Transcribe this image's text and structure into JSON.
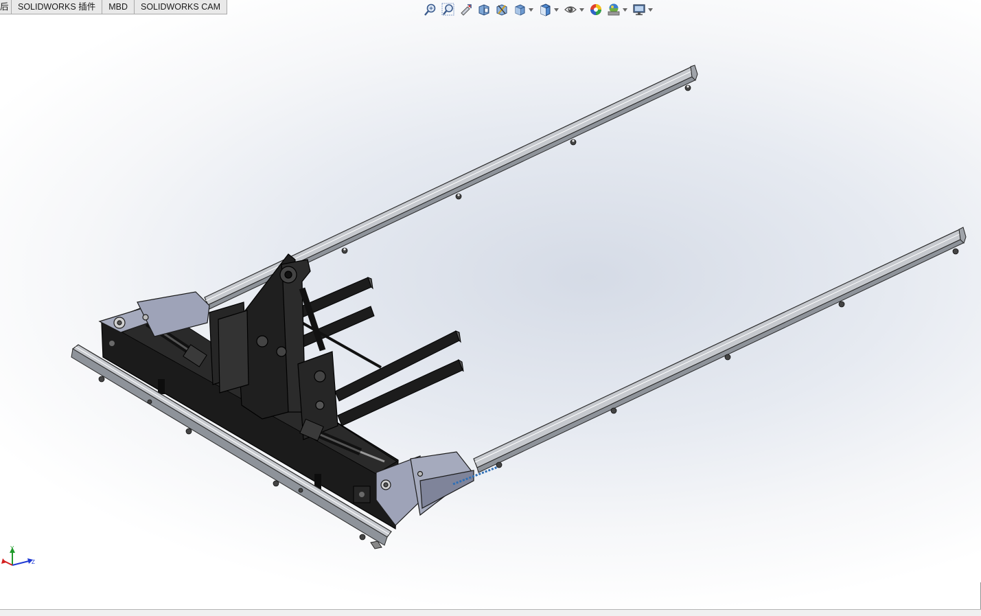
{
  "tabs": [
    {
      "label": "后",
      "name": "tab-partial"
    },
    {
      "label": "SOLIDWORKS 插件",
      "name": "tab-solidworks-addins"
    },
    {
      "label": "MBD",
      "name": "tab-mbd"
    },
    {
      "label": "SOLIDWORKS CAM",
      "name": "tab-solidworks-cam"
    }
  ],
  "view_toolbar": [
    {
      "icon": "zoom-to-fit-icon"
    },
    {
      "icon": "zoom-to-area-icon"
    },
    {
      "icon": "previous-view-icon"
    },
    {
      "icon": "section-view-icon"
    },
    {
      "icon": "dynamic-annotation-views-icon"
    },
    {
      "icon": "view-orientation-icon",
      "dropdown": true
    },
    {
      "icon": "display-style-icon",
      "dropdown": true
    },
    {
      "icon": "hide-show-items-icon",
      "dropdown": true
    },
    {
      "icon": "edit-appearance-icon"
    },
    {
      "icon": "apply-scene-icon",
      "dropdown": true
    },
    {
      "icon": "view-settings-icon",
      "dropdown": true
    }
  ],
  "triad": {
    "y_label": "Y",
    "z_label": "Z"
  },
  "colors": {
    "background_center": "#d5dbe6",
    "rail_silver": "#bfc3c9",
    "frame_black": "#1c1c1c",
    "bracket_lavender": "#9ea3b8",
    "axis_x": "#d42020",
    "axis_y": "#1f9a2a",
    "axis_z": "#1f3ad4"
  }
}
